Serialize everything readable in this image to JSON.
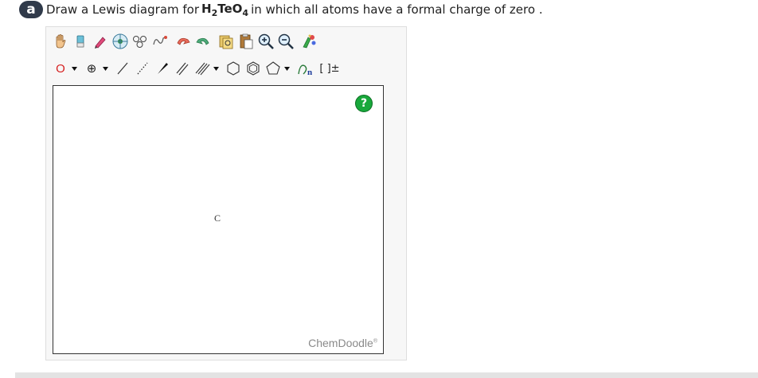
{
  "question": {
    "badge": "a",
    "prefix": "Draw a Lewis diagram for",
    "formula_h": "H",
    "formula_h_sub": "2",
    "formula_te": "TeO",
    "formula_o_sub": "4",
    "suffix": "in which all atoms have a formal charge of zero ."
  },
  "toolbar": {
    "row1": [
      "hand-icon",
      "eraser-icon",
      "marker-icon",
      "template-icon",
      "ring-flip-icon",
      "chain-icon",
      "undo-icon",
      "redo-icon",
      "copy-icon",
      "paste-icon",
      "zoom-in-icon",
      "zoom-out-icon",
      "clean-icon"
    ],
    "row2": {
      "atom_label": "O",
      "charge_label": "⊕",
      "sgroup_label": "n",
      "bracket_label": "[ ]±"
    }
  },
  "canvas": {
    "atom": "C",
    "help_label": "?",
    "brand": "ChemDoodle",
    "brand_mark": "®"
  },
  "colors": {
    "help_green": "#18a83b",
    "badge_bg": "#303a4a",
    "atom_red": "#d62020"
  }
}
